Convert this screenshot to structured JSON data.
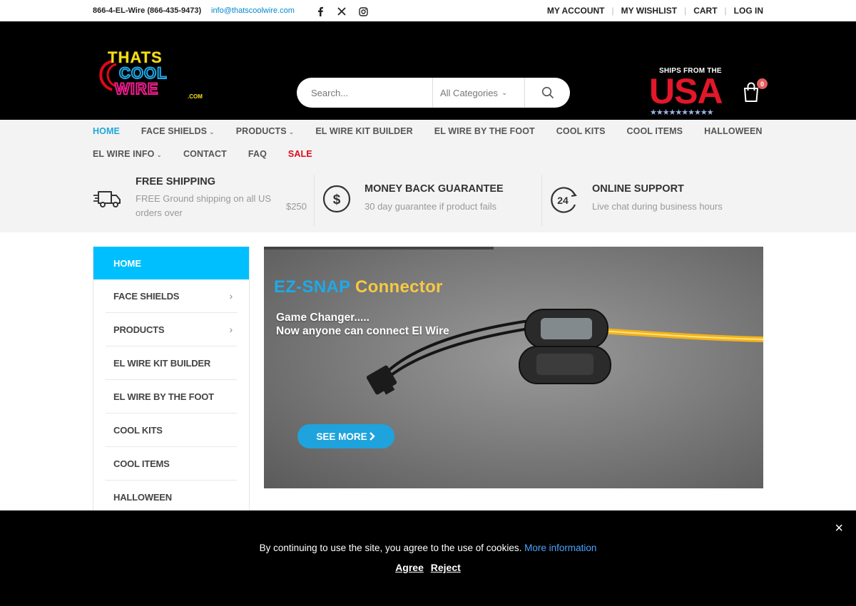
{
  "topbar": {
    "phone": "866-4-EL-Wire (866-435-9473)",
    "email": "info@thatscoolwire.com",
    "social": [
      "facebook-icon",
      "x-icon",
      "instagram-icon"
    ],
    "links": [
      "MY ACCOUNT",
      "MY WISHLIST",
      "CART",
      "LOG IN"
    ]
  },
  "header": {
    "logo_text": [
      "THATS",
      "COOL",
      "WIRE",
      ".COM"
    ],
    "search_placeholder": "Search...",
    "category_select": "All Categories",
    "ships_text": "SHIPS FROM THE",
    "usa_text": "USA",
    "usa_stars": "★★★★★★★★★★",
    "cart_count": "0"
  },
  "nav": {
    "row1": [
      {
        "label": "HOME",
        "dropdown": false
      },
      {
        "label": "FACE SHIELDS",
        "dropdown": true
      },
      {
        "label": "PRODUCTS",
        "dropdown": true
      },
      {
        "label": "EL WIRE KIT BUILDER",
        "dropdown": false
      },
      {
        "label": "EL WIRE BY THE FOOT",
        "dropdown": false
      },
      {
        "label": "COOL KITS",
        "dropdown": false
      },
      {
        "label": "COOL ITEMS",
        "dropdown": false
      },
      {
        "label": "HALLOWEEN",
        "dropdown": false
      }
    ],
    "row2": [
      {
        "label": "EL WIRE INFO",
        "dropdown": true
      },
      {
        "label": "CONTACT",
        "dropdown": false
      },
      {
        "label": "FAQ",
        "dropdown": false
      },
      {
        "label": "SALE",
        "dropdown": false
      }
    ]
  },
  "features": [
    {
      "title": "FREE SHIPPING",
      "desc": "FREE Ground shipping on all US orders over",
      "extra": "$250"
    },
    {
      "title": "MONEY BACK GUARANTEE",
      "desc": "30 day guarantee if product fails"
    },
    {
      "title": "ONLINE SUPPORT",
      "desc": "Live chat during business hours"
    }
  ],
  "sidebar": {
    "home": "HOME",
    "items": [
      {
        "label": "FACE SHIELDS",
        "arrow": true
      },
      {
        "label": "PRODUCTS",
        "arrow": true
      },
      {
        "label": "EL WIRE KIT BUILDER",
        "arrow": false
      },
      {
        "label": "EL WIRE BY THE FOOT",
        "arrow": false
      },
      {
        "label": "COOL KITS",
        "arrow": false
      },
      {
        "label": "COOL ITEMS",
        "arrow": false
      },
      {
        "label": "HALLOWEEN",
        "arrow": false
      }
    ]
  },
  "banner": {
    "title_part1": "EZ-SNAP",
    "title_part2": "Connector",
    "sub_line1": "Game Changer.....",
    "sub_line2": "Now anyone can connect El Wire",
    "button": "SEE MORE"
  },
  "cookie": {
    "message": "By continuing to use the site, you agree to the use of cookies.",
    "more_link": "More information",
    "agree": "Agree",
    "reject": "Reject",
    "close": "×"
  }
}
